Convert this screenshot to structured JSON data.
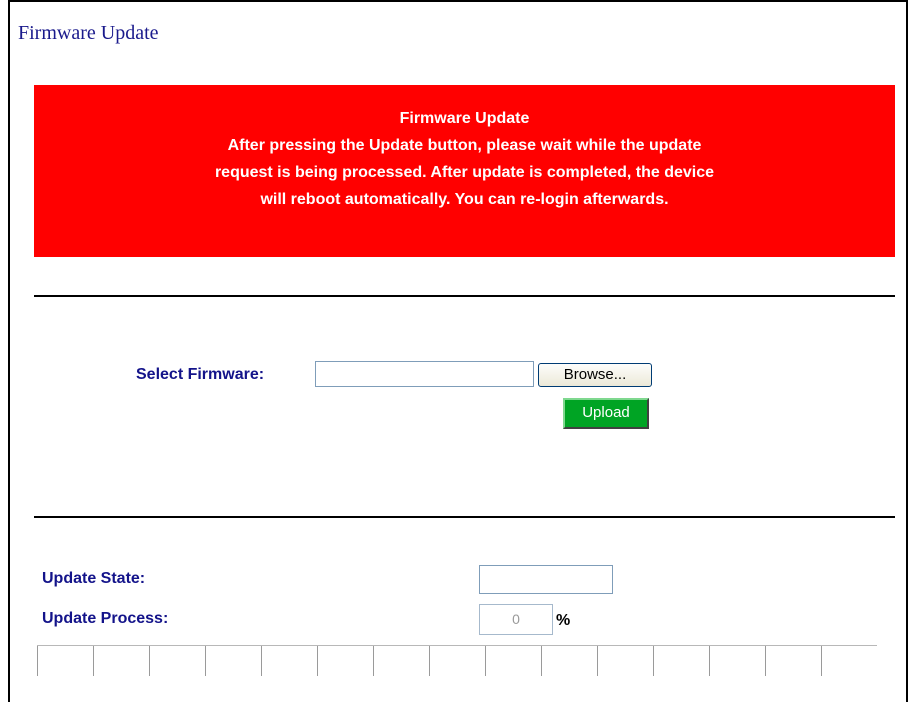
{
  "page": {
    "title": "Firmware Update"
  },
  "notice": {
    "heading": "Firmware Update",
    "lines": [
      "After pressing the Update button, please wait while the update",
      "request is being processed. After update is completed, the device",
      "will reboot automatically. You can re-login afterwards."
    ],
    "background_color": "#ff0000"
  },
  "firmware": {
    "label": "Select Firmware:",
    "file_value": "",
    "browse_label": "Browse...",
    "upload_label": "Upload",
    "upload_color": "#00a424"
  },
  "status": {
    "state_label": "Update State:",
    "state_value": "",
    "process_label": "Update Process:",
    "process_value": "0",
    "percent_symbol": "%",
    "progress_fraction": 0,
    "progress_segments": 15
  }
}
